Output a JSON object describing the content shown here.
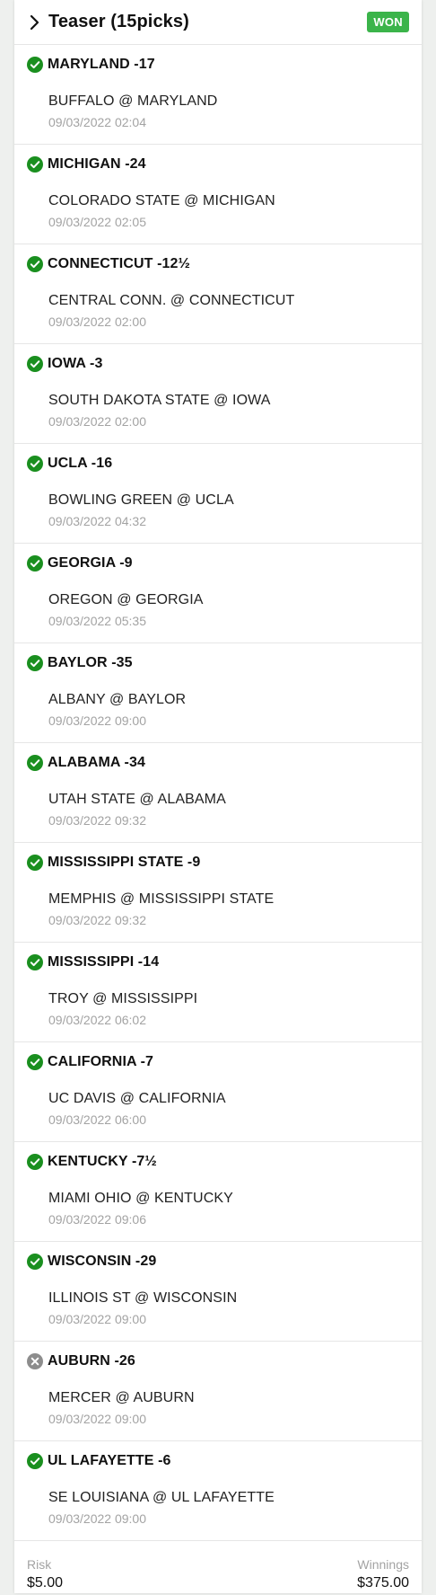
{
  "bet": {
    "title": "Teaser (15picks)",
    "status": "WON"
  },
  "colors": {
    "won_green": "#1a8f1f",
    "lost_gray": "#8d8d8d",
    "badge_green": "#3bb44a"
  },
  "picks": [
    {
      "team": "MARYLAND -17",
      "game": "BUFFALO @ MARYLAND",
      "date": "09/03/2022 02:04",
      "result": "won",
      "icon": "check-circle-icon"
    },
    {
      "team": "MICHIGAN -24",
      "game": "COLORADO STATE @ MICHIGAN",
      "date": "09/03/2022 02:05",
      "result": "won",
      "icon": "check-circle-icon"
    },
    {
      "team": "CONNECTICUT -12½",
      "game": "CENTRAL CONN. @ CONNECTICUT",
      "date": "09/03/2022 02:00",
      "result": "won",
      "icon": "check-circle-icon"
    },
    {
      "team": "IOWA -3",
      "game": "SOUTH DAKOTA STATE @ IOWA",
      "date": "09/03/2022 02:00",
      "result": "won",
      "icon": "check-circle-icon"
    },
    {
      "team": "UCLA -16",
      "game": "BOWLING GREEN @ UCLA",
      "date": "09/03/2022 04:32",
      "result": "won",
      "icon": "check-circle-icon"
    },
    {
      "team": "GEORGIA -9",
      "game": "OREGON @ GEORGIA",
      "date": "09/03/2022 05:35",
      "result": "won",
      "icon": "check-circle-icon"
    },
    {
      "team": "BAYLOR -35",
      "game": "ALBANY @ BAYLOR",
      "date": "09/03/2022 09:00",
      "result": "won",
      "icon": "check-circle-icon"
    },
    {
      "team": "ALABAMA -34",
      "game": "UTAH STATE @ ALABAMA",
      "date": "09/03/2022 09:32",
      "result": "won",
      "icon": "check-circle-icon"
    },
    {
      "team": "MISSISSIPPI STATE -9",
      "game": "MEMPHIS @ MISSISSIPPI STATE",
      "date": "09/03/2022 09:32",
      "result": "won",
      "icon": "check-circle-icon"
    },
    {
      "team": "MISSISSIPPI -14",
      "game": "TROY @ MISSISSIPPI",
      "date": "09/03/2022 06:02",
      "result": "won",
      "icon": "check-circle-icon"
    },
    {
      "team": "CALIFORNIA -7",
      "game": "UC DAVIS @ CALIFORNIA",
      "date": "09/03/2022 06:00",
      "result": "won",
      "icon": "check-circle-icon"
    },
    {
      "team": "KENTUCKY -7½",
      "game": "MIAMI OHIO @ KENTUCKY",
      "date": "09/03/2022 09:06",
      "result": "won",
      "icon": "check-circle-icon"
    },
    {
      "team": "WISCONSIN -29",
      "game": "ILLINOIS ST @ WISCONSIN",
      "date": "09/03/2022 09:00",
      "result": "won",
      "icon": "check-circle-icon"
    },
    {
      "team": "AUBURN -26",
      "game": "MERCER @ AUBURN",
      "date": "09/03/2022 09:00",
      "result": "lost",
      "icon": "x-circle-icon"
    },
    {
      "team": "UL LAFAYETTE -6",
      "game": "SE LOUISIANA @ UL LAFAYETTE",
      "date": "09/03/2022 09:00",
      "result": "won",
      "icon": "check-circle-icon"
    }
  ],
  "footer": {
    "risk_label": "Risk",
    "risk_value": "$5.00",
    "winnings_label": "Winnings",
    "winnings_value": "$375.00"
  }
}
